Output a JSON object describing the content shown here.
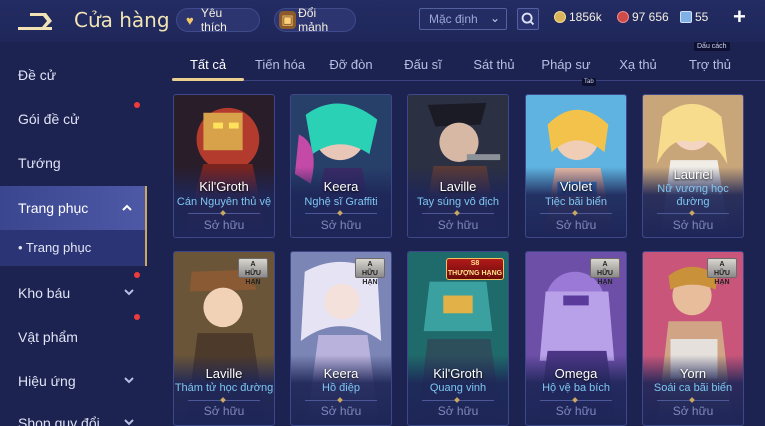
{
  "header": {
    "title": "Cửa hàng",
    "favorites_label": "Yêu thích",
    "exchange_label": "Đổi mảnh",
    "sort_value": "Mặc định",
    "gold": "1856k",
    "ruby": "97 656",
    "voucher": "55",
    "plus_label": "+",
    "tooltip": "Dấu cách",
    "tab_hint": "Tab"
  },
  "sidebar": {
    "items": [
      {
        "label": "Đề cử"
      },
      {
        "label": "Gói đề cử"
      },
      {
        "label": "Tướng"
      },
      {
        "label": "Trang phục"
      },
      {
        "label": "• Trang phục"
      },
      {
        "label": "Kho báu"
      },
      {
        "label": "Vật phẩm"
      },
      {
        "label": "Hiệu ứng"
      },
      {
        "label": "Shop quy đổi"
      }
    ]
  },
  "tabs": [
    "Tất cả",
    "Tiến hóa",
    "Đỡ đòn",
    "Đấu sĩ",
    "Sát thủ",
    "Pháp sư",
    "Xạ thủ",
    "Trợ thủ"
  ],
  "cards": [
    {
      "name": "Kil'Groth",
      "skin": "Cán Nguyên thủ vệ",
      "status": "Sở hữu"
    },
    {
      "name": "Keera",
      "skin": "Nghệ sĩ Graffiti",
      "status": "Sở hữu"
    },
    {
      "name": "Laville",
      "skin": "Tay súng vô địch",
      "status": "Sở hữu"
    },
    {
      "name": "Violet",
      "skin": "Tiệc bãi biển",
      "status": "Sở hữu"
    },
    {
      "name": "Lauriel",
      "skin": "Nữ vương học đường",
      "status": "Sở hữu"
    },
    {
      "name": "Laville",
      "skin": "Thám tử học đường",
      "status": "Sở hữu",
      "badge": "A\nHỮU HẠN"
    },
    {
      "name": "Keera",
      "skin": "Hồ điệp",
      "status": "Sở hữu",
      "badge": "A\nHỮU HẠN"
    },
    {
      "name": "Kil'Groth",
      "skin": "Quang vinh",
      "status": "Sở hữu",
      "badge": "S8\nTHƯỢNG HẠNG"
    },
    {
      "name": "Omega",
      "skin": "Hộ vệ ba bích",
      "status": "Sở hữu",
      "badge": "A\nHỮU HẠN"
    },
    {
      "name": "Yorn",
      "skin": "Soái ca bãi biển",
      "status": "Sở hữu",
      "badge": "A\nHỮU HẠN"
    }
  ],
  "colors": {
    "background": "#1c2350",
    "accent_gold": "#e9d08f",
    "skin_text": "#7ec6f2",
    "sidebar_active": "#4e59a6"
  }
}
